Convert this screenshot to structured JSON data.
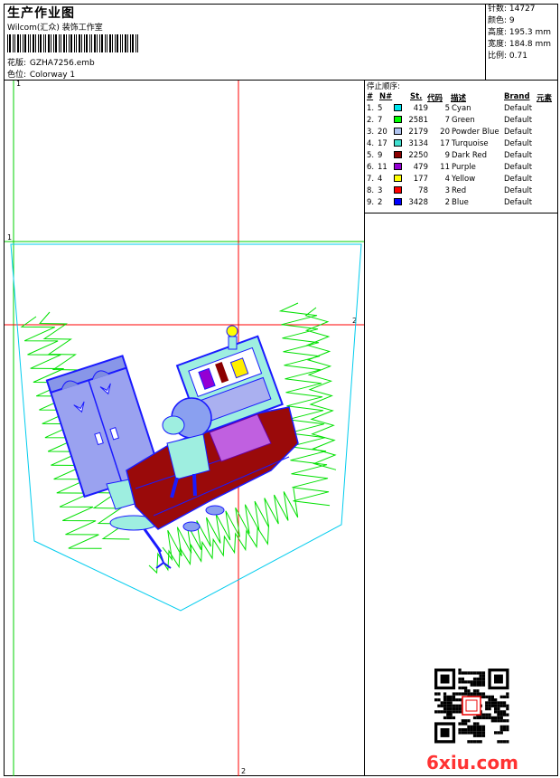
{
  "header": {
    "title": "生产作业图",
    "subtitle": "Wilcom(汇众) 装饰工作室",
    "design_label": "花版:",
    "design_value": "GZHA7256.emb",
    "colorway_label": "色位:",
    "colorway_value": "Colorway 1"
  },
  "stats": {
    "stitches": "针数: 14727",
    "colors": "颜色: 9",
    "height": "高度: 195.3 mm",
    "width": "宽度: 184.8 mm",
    "scale": "比例: 0.71"
  },
  "legend": {
    "caption": "停止顺序:",
    "headers": {
      "num": "#",
      "n": "N#",
      "st": "St.",
      "code": "代码",
      "desc": "描述",
      "brand": "Brand",
      "element": "元素"
    },
    "rows": [
      {
        "idx": "1.",
        "n": "5",
        "st": "419",
        "code": "5",
        "desc": "Cyan",
        "brand": "Default",
        "color": "#00e5ee"
      },
      {
        "idx": "2.",
        "n": "7",
        "st": "2581",
        "code": "7",
        "desc": "Green",
        "brand": "Default",
        "color": "#00ff00"
      },
      {
        "idx": "3.",
        "n": "20",
        "st": "2179",
        "code": "20",
        "desc": "Powder Blue",
        "brand": "Default",
        "color": "#b0c4f0"
      },
      {
        "idx": "4.",
        "n": "17",
        "st": "3134",
        "code": "17",
        "desc": "Turquoise",
        "brand": "Default",
        "color": "#40e0d0"
      },
      {
        "idx": "5.",
        "n": "9",
        "st": "2250",
        "code": "9",
        "desc": "Dark Red",
        "brand": "Default",
        "color": "#8b0000"
      },
      {
        "idx": "6.",
        "n": "11",
        "st": "479",
        "code": "11",
        "desc": "Purple",
        "brand": "Default",
        "color": "#9400d3"
      },
      {
        "idx": "7.",
        "n": "4",
        "st": "177",
        "code": "4",
        "desc": "Yellow",
        "brand": "Default",
        "color": "#ffff00"
      },
      {
        "idx": "8.",
        "n": "3",
        "st": "78",
        "code": "3",
        "desc": "Red",
        "brand": "Default",
        "color": "#ff0000"
      },
      {
        "idx": "9.",
        "n": "2",
        "st": "3428",
        "code": "2",
        "desc": "Blue",
        "brand": "Default",
        "color": "#0000ff"
      }
    ]
  },
  "markers": {
    "v1": "1",
    "h1": "1",
    "v2": "2",
    "h2": "2"
  },
  "watermark": "6xiu.com",
  "colors": {
    "frame": "#000000",
    "guide_green": "#00d000",
    "guide_red": "#ff0000",
    "outline": "#00ccee",
    "watermark": "#ff3333"
  }
}
